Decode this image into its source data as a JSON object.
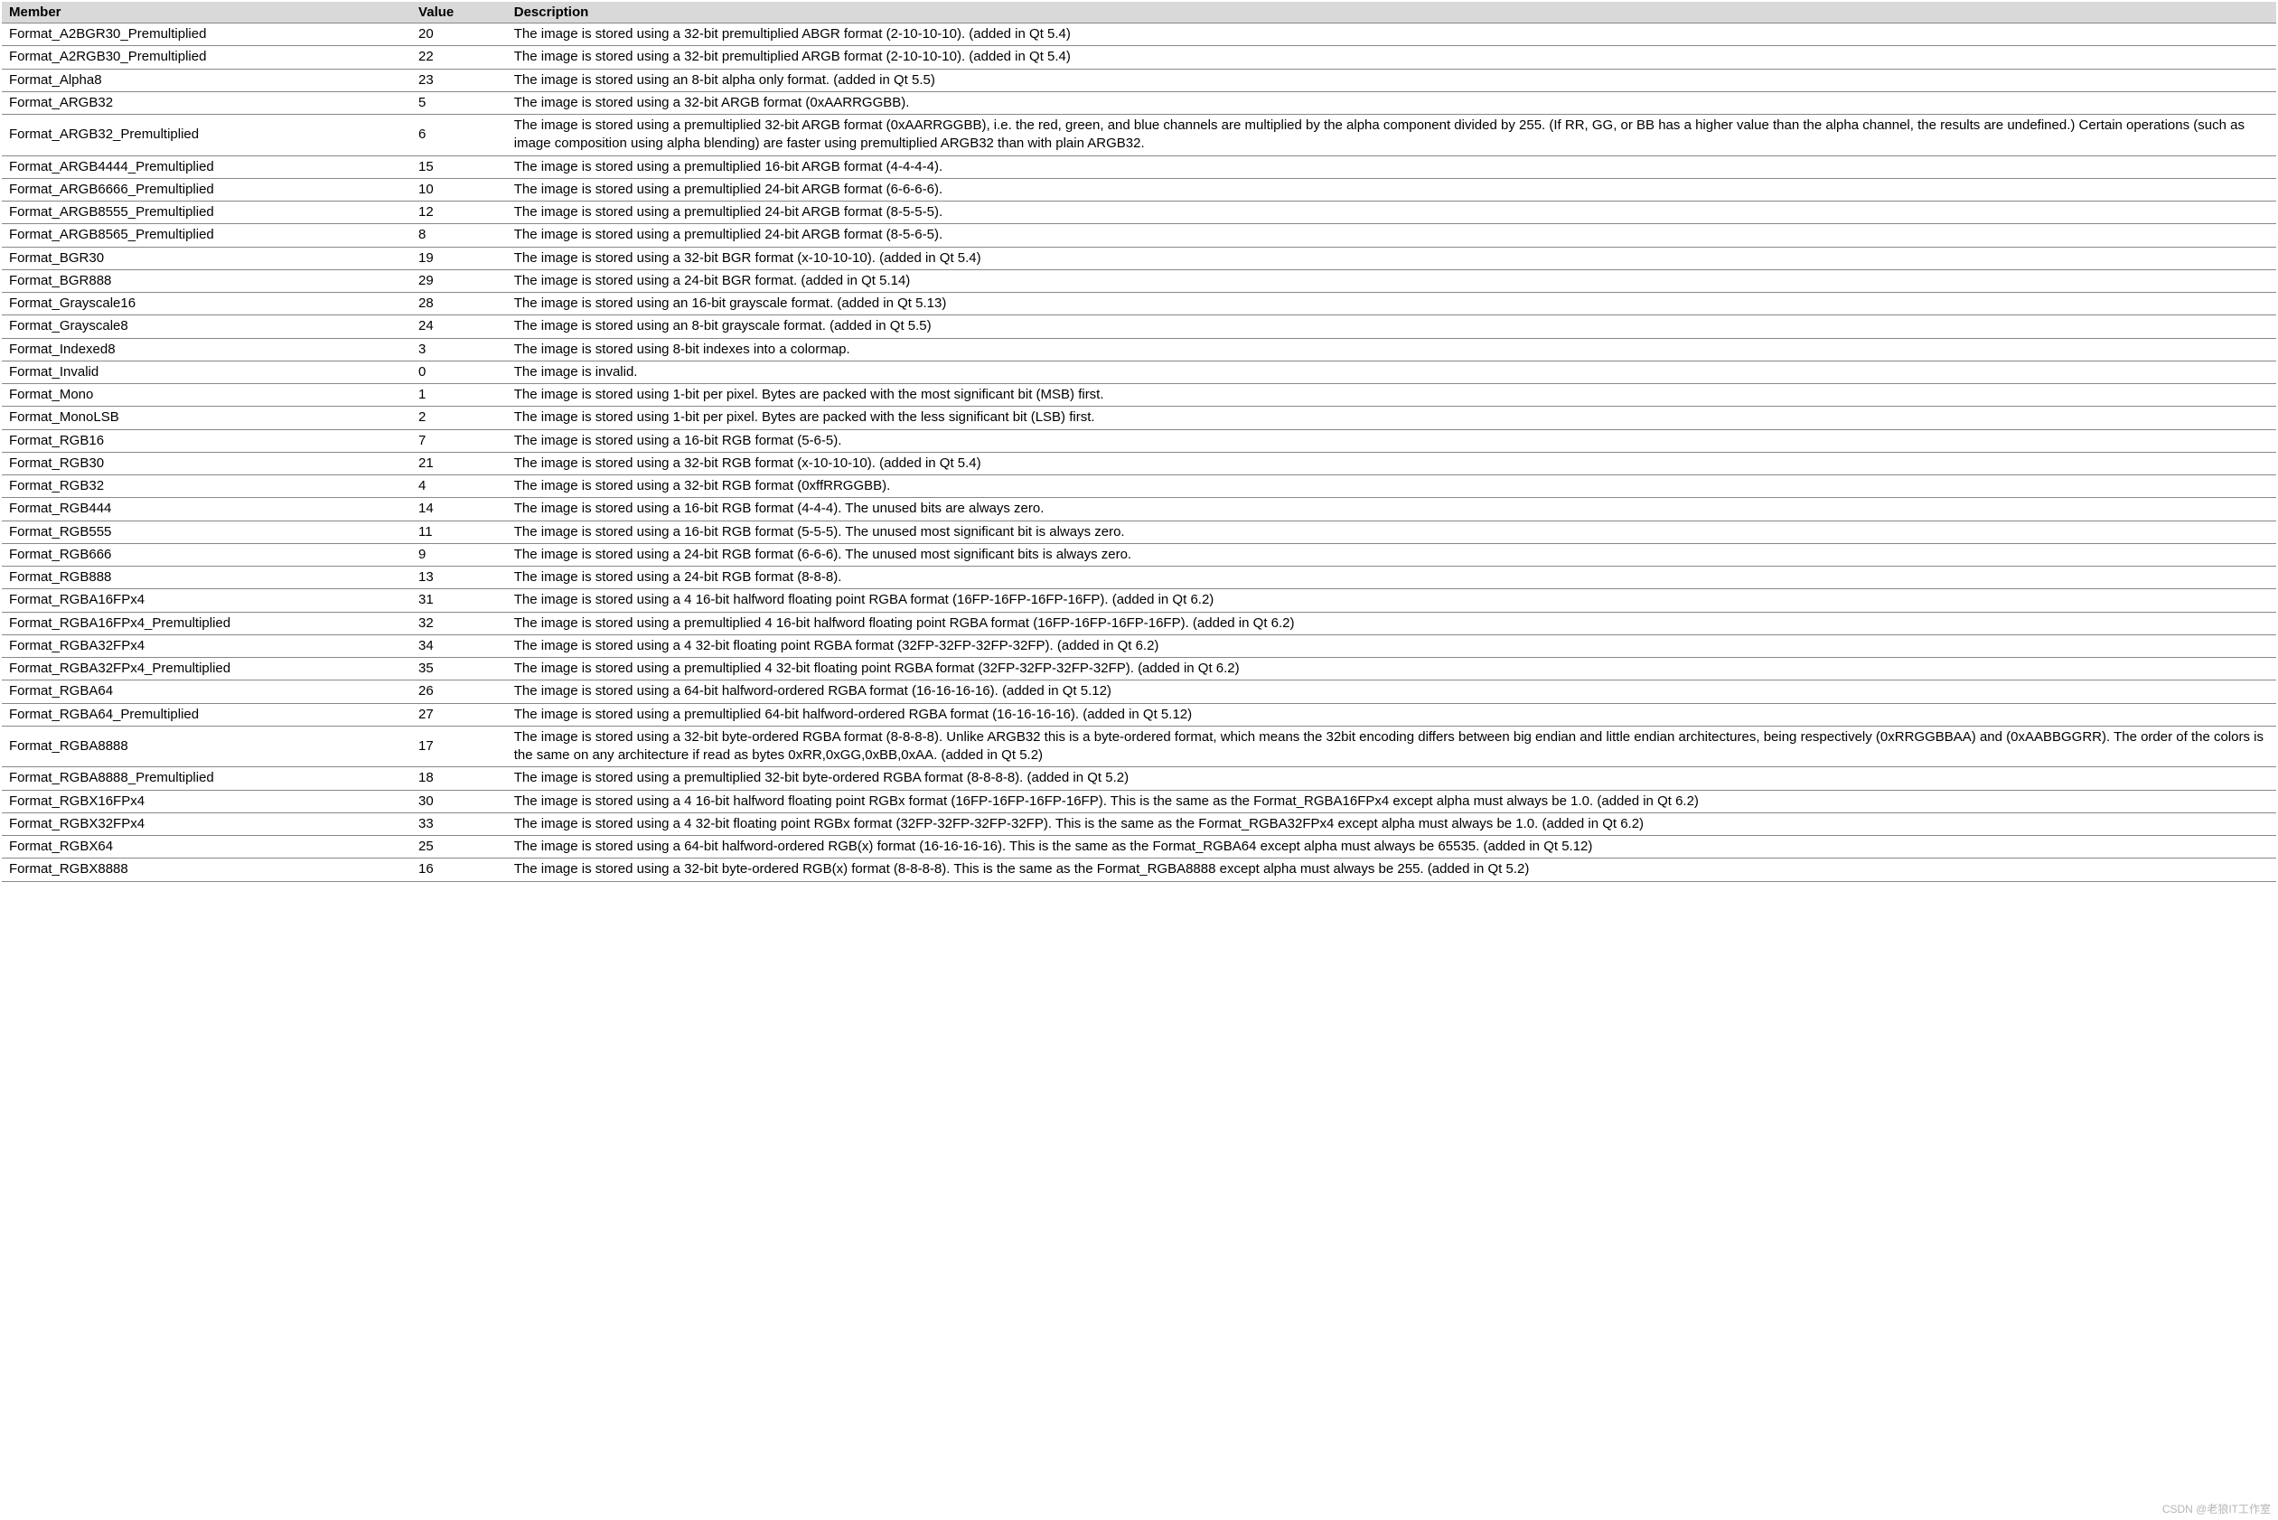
{
  "headers": {
    "member": "Member",
    "value": "Value",
    "description": "Description"
  },
  "watermark": "CSDN @老狼IT工作室",
  "rows": [
    {
      "member": "Format_A2BGR30_Premultiplied",
      "value": "20",
      "desc": "The image is stored using a 32-bit premultiplied ABGR format (2-10-10-10). (added in Qt 5.4)"
    },
    {
      "member": "Format_A2RGB30_Premultiplied",
      "value": "22",
      "desc": "The image is stored using a 32-bit premultiplied ARGB format (2-10-10-10). (added in Qt 5.4)"
    },
    {
      "member": "Format_Alpha8",
      "value": "23",
      "desc": "The image is stored using an 8-bit alpha only format. (added in Qt 5.5)"
    },
    {
      "member": "Format_ARGB32",
      "value": "5",
      "desc": "The image is stored using a 32-bit ARGB format (0xAARRGGBB)."
    },
    {
      "member": "Format_ARGB32_Premultiplied",
      "value": "6",
      "desc": "The image is stored using a premultiplied 32-bit ARGB format (0xAARRGGBB), i.e. the red, green, and blue channels are multiplied by the alpha component divided by 255. (If RR, GG, or BB has a higher value than the alpha channel, the results are undefined.) Certain operations (such as image composition using alpha blending) are faster using premultiplied ARGB32 than with plain ARGB32."
    },
    {
      "member": "Format_ARGB4444_Premultiplied",
      "value": "15",
      "desc": "The image is stored using a premultiplied 16-bit ARGB format (4-4-4-4)."
    },
    {
      "member": "Format_ARGB6666_Premultiplied",
      "value": "10",
      "desc": "The image is stored using a premultiplied 24-bit ARGB format (6-6-6-6)."
    },
    {
      "member": "Format_ARGB8555_Premultiplied",
      "value": "12",
      "desc": "The image is stored using a premultiplied 24-bit ARGB format (8-5-5-5)."
    },
    {
      "member": "Format_ARGB8565_Premultiplied",
      "value": "8",
      "desc": "The image is stored using a premultiplied 24-bit ARGB format (8-5-6-5)."
    },
    {
      "member": "Format_BGR30",
      "value": "19",
      "desc": "The image is stored using a 32-bit BGR format (x-10-10-10). (added in Qt 5.4)"
    },
    {
      "member": "Format_BGR888",
      "value": "29",
      "desc": "The image is stored using a 24-bit BGR format. (added in Qt 5.14)"
    },
    {
      "member": "Format_Grayscale16",
      "value": "28",
      "desc": "The image is stored using an 16-bit grayscale format. (added in Qt 5.13)"
    },
    {
      "member": "Format_Grayscale8",
      "value": "24",
      "desc": "The image is stored using an 8-bit grayscale format. (added in Qt 5.5)"
    },
    {
      "member": "Format_Indexed8",
      "value": "3",
      "desc": "The image is stored using 8-bit indexes into a colormap."
    },
    {
      "member": "Format_Invalid",
      "value": "0",
      "desc": "The image is invalid."
    },
    {
      "member": "Format_Mono",
      "value": "1",
      "desc": "The image is stored using 1-bit per pixel. Bytes are packed with the most significant bit (MSB) first."
    },
    {
      "member": "Format_MonoLSB",
      "value": "2",
      "desc": "The image is stored using 1-bit per pixel. Bytes are packed with the less significant bit (LSB) first."
    },
    {
      "member": "Format_RGB16",
      "value": "7",
      "desc": "The image is stored using a 16-bit RGB format (5-6-5)."
    },
    {
      "member": "Format_RGB30",
      "value": "21",
      "desc": "The image is stored using a 32-bit RGB format (x-10-10-10). (added in Qt 5.4)"
    },
    {
      "member": "Format_RGB32",
      "value": "4",
      "desc": "The image is stored using a 32-bit RGB format (0xffRRGGBB)."
    },
    {
      "member": "Format_RGB444",
      "value": "14",
      "desc": "The image is stored using a 16-bit RGB format (4-4-4). The unused bits are always zero."
    },
    {
      "member": "Format_RGB555",
      "value": "11",
      "desc": "The image is stored using a 16-bit RGB format (5-5-5). The unused most significant bit is always zero."
    },
    {
      "member": "Format_RGB666",
      "value": "9",
      "desc": "The image is stored using a 24-bit RGB format (6-6-6). The unused most significant bits is always zero."
    },
    {
      "member": "Format_RGB888",
      "value": "13",
      "desc": "The image is stored using a 24-bit RGB format (8-8-8)."
    },
    {
      "member": "Format_RGBA16FPx4",
      "value": "31",
      "desc": "The image is stored using a 4 16-bit halfword floating point RGBA format (16FP-16FP-16FP-16FP). (added in Qt 6.2)"
    },
    {
      "member": "Format_RGBA16FPx4_Premultiplied",
      "value": "32",
      "desc": "The image is stored using a premultiplied 4 16-bit halfword floating point RGBA format (16FP-16FP-16FP-16FP). (added in Qt 6.2)"
    },
    {
      "member": "Format_RGBA32FPx4",
      "value": "34",
      "desc": "The image is stored using a 4 32-bit floating point RGBA format (32FP-32FP-32FP-32FP). (added in Qt 6.2)"
    },
    {
      "member": "Format_RGBA32FPx4_Premultiplied",
      "value": "35",
      "desc": "The image is stored using a premultiplied 4 32-bit floating point RGBA format (32FP-32FP-32FP-32FP). (added in Qt 6.2)"
    },
    {
      "member": "Format_RGBA64",
      "value": "26",
      "desc": "The image is stored using a 64-bit halfword-ordered RGBA format (16-16-16-16). (added in Qt 5.12)"
    },
    {
      "member": "Format_RGBA64_Premultiplied",
      "value": "27",
      "desc": "The image is stored using a premultiplied 64-bit halfword-ordered RGBA format (16-16-16-16). (added in Qt 5.12)"
    },
    {
      "member": "Format_RGBA8888",
      "value": "17",
      "desc": "The image is stored using a 32-bit byte-ordered RGBA format (8-8-8-8). Unlike ARGB32 this is a byte-ordered format, which means the 32bit encoding differs between big endian and little endian architectures, being respectively (0xRRGGBBAA) and (0xAABBGGRR). The order of the colors is the same on any architecture if read as bytes 0xRR,0xGG,0xBB,0xAA. (added in Qt 5.2)"
    },
    {
      "member": "Format_RGBA8888_Premultiplied",
      "value": "18",
      "desc": "The image is stored using a premultiplied 32-bit byte-ordered RGBA format (8-8-8-8). (added in Qt 5.2)"
    },
    {
      "member": "Format_RGBX16FPx4",
      "value": "30",
      "desc": "The image is stored using a 4 16-bit halfword floating point RGBx format (16FP-16FP-16FP-16FP). This is the same as the Format_RGBA16FPx4 except alpha must always be 1.0. (added in Qt 6.2)"
    },
    {
      "member": "Format_RGBX32FPx4",
      "value": "33",
      "desc": "The image is stored using a 4 32-bit floating point RGBx format (32FP-32FP-32FP-32FP). This is the same as the Format_RGBA32FPx4 except alpha must always be 1.0. (added in Qt 6.2)"
    },
    {
      "member": "Format_RGBX64",
      "value": "25",
      "desc": "The image is stored using a 64-bit halfword-ordered RGB(x) format (16-16-16-16). This is the same as the Format_RGBA64 except alpha must always be 65535. (added in Qt 5.12)"
    },
    {
      "member": "Format_RGBX8888",
      "value": "16",
      "desc": "The image is stored using a 32-bit byte-ordered RGB(x) format (8-8-8-8). This is the same as the Format_RGBA8888 except alpha must always be 255. (added in Qt 5.2)"
    }
  ]
}
